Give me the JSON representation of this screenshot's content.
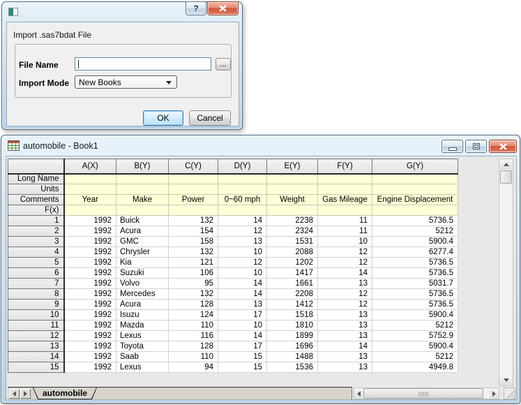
{
  "dialog": {
    "heading": "Import .sas7bdat File",
    "help_button": "?",
    "file_name": {
      "label": "File Name",
      "value": "",
      "browse": "..."
    },
    "import_mode": {
      "label": "Import Mode",
      "value": "New Books"
    },
    "buttons": {
      "ok": "OK",
      "cancel": "Cancel"
    }
  },
  "book_window": {
    "title": "automobile - Book1",
    "sheet_tab": "automobile",
    "grid": {
      "column_headers": [
        "A(X)",
        "B(Y)",
        "C(Y)",
        "D(Y)",
        "E(Y)",
        "F(Y)",
        "G(Y)"
      ],
      "label_rows": [
        {
          "header": "Long Name",
          "cells": [
            "",
            "",
            "",
            "",
            "",
            "",
            ""
          ]
        },
        {
          "header": "Units",
          "cells": [
            "",
            "",
            "",
            "",
            "",
            "",
            ""
          ]
        },
        {
          "header": "Comments",
          "cells": [
            "Year",
            "Make",
            "Power",
            "0~60 mph",
            "Weight",
            "Gas Mileage",
            "Engine Displacement"
          ]
        },
        {
          "header": "F(x)",
          "cells": [
            "",
            "",
            "",
            "",
            "",
            "",
            ""
          ]
        }
      ],
      "data_rows": [
        {
          "header": "1",
          "cells": [
            "1992",
            "Buick",
            "132",
            "14",
            "2238",
            "11",
            "5736.5"
          ]
        },
        {
          "header": "2",
          "cells": [
            "1992",
            "Acura",
            "154",
            "12",
            "2324",
            "11",
            "5212"
          ]
        },
        {
          "header": "3",
          "cells": [
            "1992",
            "GMC",
            "158",
            "13",
            "1531",
            "10",
            "5900.4"
          ]
        },
        {
          "header": "4",
          "cells": [
            "1992",
            "Chrysler",
            "132",
            "10",
            "2088",
            "12",
            "6277.4"
          ]
        },
        {
          "header": "5",
          "cells": [
            "1992",
            "Kia",
            "121",
            "12",
            "1202",
            "12",
            "5736.5"
          ]
        },
        {
          "header": "6",
          "cells": [
            "1992",
            "Suzuki",
            "106",
            "10",
            "1417",
            "14",
            "5736.5"
          ]
        },
        {
          "header": "7",
          "cells": [
            "1992",
            "Volvo",
            "95",
            "14",
            "1661",
            "13",
            "5031.7"
          ]
        },
        {
          "header": "8",
          "cells": [
            "1992",
            "Mercedes",
            "132",
            "14",
            "2208",
            "12",
            "5736.5"
          ]
        },
        {
          "header": "9",
          "cells": [
            "1992",
            "Acura",
            "128",
            "13",
            "1412",
            "12",
            "5736.5"
          ]
        },
        {
          "header": "10",
          "cells": [
            "1992",
            "Isuzu",
            "124",
            "17",
            "1518",
            "13",
            "5900.4"
          ]
        },
        {
          "header": "11",
          "cells": [
            "1992",
            "Mazda",
            "110",
            "10",
            "1810",
            "13",
            "5212"
          ]
        },
        {
          "header": "12",
          "cells": [
            "1992",
            "Lexus",
            "116",
            "14",
            "1899",
            "13",
            "5752.9"
          ]
        },
        {
          "header": "13",
          "cells": [
            "1992",
            "Toyota",
            "128",
            "17",
            "1696",
            "14",
            "5900.4"
          ]
        },
        {
          "header": "14",
          "cells": [
            "1992",
            "Saab",
            "110",
            "15",
            "1488",
            "13",
            "5212"
          ]
        },
        {
          "header": "15",
          "cells": [
            "1992",
            "Lexus",
            "94",
            "15",
            "1536",
            "13",
            "4949.8"
          ]
        }
      ]
    }
  },
  "colors": {
    "header_yellow": "#ffffd8",
    "chrome_blue_light": "#e9f3fb",
    "chrome_blue": "#bcd2e6",
    "chrome_border": "#4f6a82",
    "close_red": "#d0553e",
    "focus_blue": "#3c7fb1",
    "dialog_bg": "#f0f0f0",
    "grid_line": "#d2d2d2",
    "header_gray": "#e3e3e3",
    "tabbar_gray": "#d8d4cc"
  }
}
